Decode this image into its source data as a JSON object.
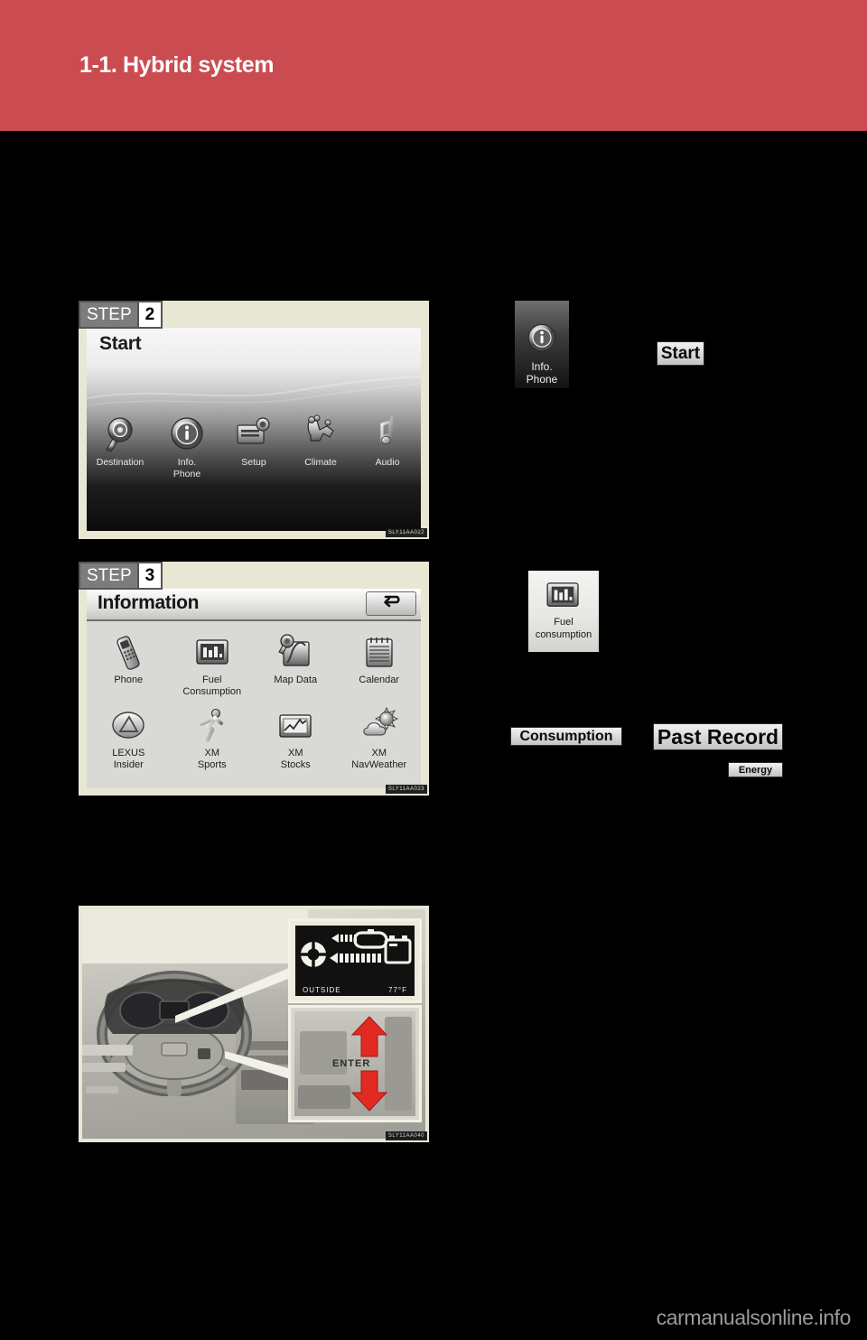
{
  "header": {
    "chapter_title": "1-1. Hybrid system",
    "bg_color": "#cb4c50"
  },
  "steps": [
    {
      "badge_word": "STEP",
      "badge_number": "2",
      "image_code": "SLY11AA022",
      "screen": {
        "title": "Start",
        "items": [
          {
            "label": "Destination",
            "icon": "destination-icon"
          },
          {
            "label": "Info.\nPhone",
            "label_line1": "Info.",
            "label_line2": "Phone",
            "icon": "info-phone-icon"
          },
          {
            "label": "Setup",
            "icon": "setup-icon"
          },
          {
            "label": "Climate",
            "icon": "climate-icon"
          },
          {
            "label": "Audio",
            "icon": "audio-icon"
          }
        ]
      }
    },
    {
      "badge_word": "STEP",
      "badge_number": "3",
      "image_code": "SLY11AA023",
      "screen": {
        "title": "Information",
        "back_icon": "back-arrow-icon",
        "items": [
          {
            "label_line1": "Phone",
            "label_line2": "",
            "icon": "phone-icon"
          },
          {
            "label_line1": "Fuel",
            "label_line2": "Consumption",
            "icon": "fuel-consumption-icon"
          },
          {
            "label_line1": "Map Data",
            "label_line2": "",
            "icon": "map-data-icon"
          },
          {
            "label_line1": "Calendar",
            "label_line2": "",
            "icon": "calendar-icon"
          },
          {
            "label_line1": "LEXUS",
            "label_line2": "Insider",
            "icon": "lexus-insider-icon"
          },
          {
            "label_line1": "XM",
            "label_line2": "Sports",
            "icon": "xm-sports-icon"
          },
          {
            "label_line1": "XM",
            "label_line2": "Stocks",
            "icon": "xm-stocks-icon"
          },
          {
            "label_line1": "XM",
            "label_line2": "NavWeather",
            "icon": "xm-navweather-icon"
          }
        ]
      }
    }
  ],
  "photo": {
    "image_code": "SLY11AA040",
    "multi_info_display": {
      "outside_label": "OUTSIDE",
      "temperature": "77°F"
    },
    "steering_switch": {
      "enter_label": "ENTER",
      "up_arrow": "arrow-up-icon",
      "down_arrow": "arrow-down-icon",
      "arrow_color": "#e02a22"
    }
  },
  "callouts": {
    "info_phone_chip": {
      "line1": "Info.",
      "line2": "Phone"
    },
    "start_chip": "Start",
    "fuel_consumption_chip": {
      "line1": "Fuel",
      "line2": "consumption"
    },
    "consumption_chip": "Consumption",
    "past_record_chip": "Past Record",
    "energy_chip": "Energy"
  },
  "footer": {
    "watermark": "carmanualsonline.info"
  }
}
